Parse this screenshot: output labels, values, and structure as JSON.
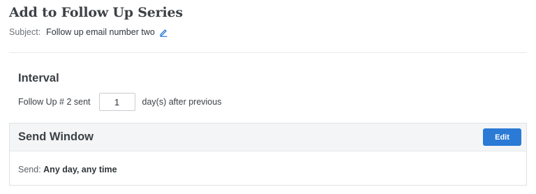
{
  "title": "Add to Follow Up Series",
  "subject": {
    "label": "Subject:",
    "value": "Follow up email number two",
    "edit_icon": "pencil-icon"
  },
  "interval": {
    "heading": "Interval",
    "prefix": "Follow Up # 2 sent",
    "days_value": "1",
    "suffix": "day(s) after previous"
  },
  "send_window": {
    "heading": "Send Window",
    "edit_label": "Edit",
    "send_label": "Send:",
    "send_value": "Any day, any time"
  },
  "colors": {
    "accent": "#2a7ad6",
    "header_bg": "#f4f5f6"
  }
}
